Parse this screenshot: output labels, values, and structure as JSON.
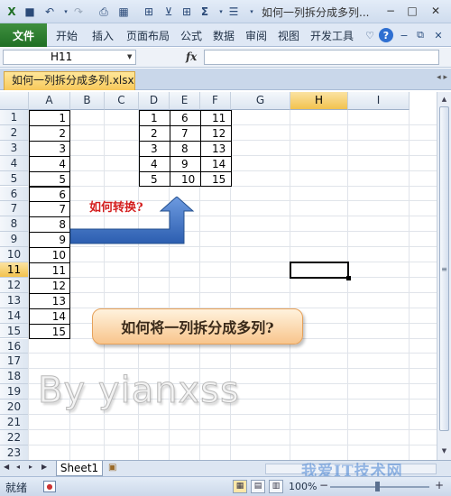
{
  "title_bar": {
    "title": "如何一列拆分成多列...",
    "minimize": "−",
    "maximize": "□",
    "close": "✕"
  },
  "ribbon": {
    "file_tab": "文件",
    "tabs": [
      "开始",
      "插入",
      "页面布局",
      "公式",
      "数据",
      "审阅",
      "视图",
      "开发工具"
    ],
    "help": "?"
  },
  "formula_bar": {
    "name_box": "H11",
    "fx": "fx",
    "formula": ""
  },
  "workbook": {
    "tab_label": "如何一列拆分成多列.xlsx"
  },
  "grid": {
    "columns": [
      "A",
      "B",
      "C",
      "D",
      "E",
      "F",
      "G",
      "H",
      "I"
    ],
    "rows": [
      "1",
      "2",
      "3",
      "4",
      "5",
      "6",
      "7",
      "8",
      "9",
      "10",
      "11",
      "12",
      "13",
      "14",
      "15",
      "16",
      "17",
      "18",
      "19",
      "20",
      "21",
      "22",
      "23"
    ],
    "selected_column": "H",
    "selected_row": "11",
    "column_a_values": [
      "1",
      "2",
      "3",
      "4",
      "5",
      "6",
      "7",
      "8",
      "9",
      "10",
      "11",
      "12",
      "13",
      "14",
      "15"
    ],
    "result_table": [
      [
        "1",
        "6",
        "11"
      ],
      [
        "2",
        "7",
        "12"
      ],
      [
        "3",
        "8",
        "13"
      ],
      [
        "4",
        "9",
        "14"
      ],
      [
        "5",
        "10",
        "15"
      ]
    ]
  },
  "shapes": {
    "arrow_label": "如何转换?",
    "callout_text": "如何将一列拆分成多列?",
    "watermark_text": "By yianxss"
  },
  "sheets": {
    "active": "Sheet1"
  },
  "status_bar": {
    "ready": "就绪",
    "zoom": "100%"
  },
  "site_watermark": "我爱IT技术网",
  "colors": {
    "file_tab": "#1f6f25",
    "selection_header": "#f2c24e",
    "arrow_blue": "#3a6fc4",
    "label_red": "#d41e1e",
    "callout_fill": "#f8c58c"
  }
}
